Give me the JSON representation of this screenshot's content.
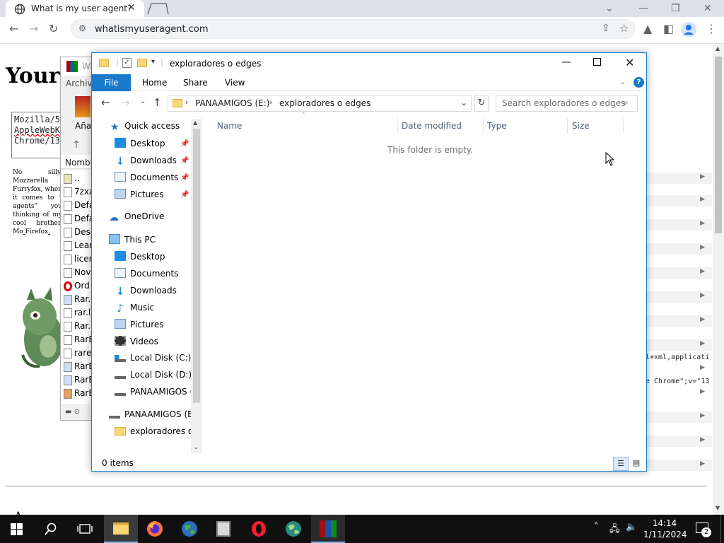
{
  "browser": {
    "tab_title": "What is my user agent?",
    "url": "whatismyuseragent.com",
    "colors": {
      "accent": "#1a73e8",
      "chrome_bg": "#dee1e6"
    }
  },
  "page": {
    "heading": "Your",
    "ua_lines": [
      "Mozilla/5",
      "AppleWebK",
      "Chrome/13"
    ],
    "paragraph_parts": [
      "No silly, Mozzarella Furryfox, when it comes to “",
      " agents” you thinking of my cool brother, ",
      "Mo",
      " ",
      "Firefox",
      "."
    ],
    "snippets": [
      "l+xml,applicati",
      "e Chrome\";v=\"13"
    ],
    "bottom_text": "A"
  },
  "winrar": {
    "title": "Wi",
    "menu": "Archivo",
    "add_label": "Aña",
    "col_name": "Nombr",
    "rows": [
      "..",
      "7zxa",
      "Defa",
      "Defa",
      "Desc",
      "Lear",
      "licer",
      "Nov",
      "Ord",
      "Rar.",
      "rar.l",
      "Rar.:",
      "RarE",
      "rare",
      "RarE",
      "RarE",
      "RarE"
    ]
  },
  "explorer": {
    "title": "exploradores o edges",
    "ribbon": {
      "file": "File",
      "home": "Home",
      "share": "Share",
      "view": "View"
    },
    "breadcrumb": [
      "PANAAMIGOS (E:)",
      "exploradores o edges"
    ],
    "search_placeholder": "Search exploradores o edges",
    "columns": {
      "name": "Name",
      "date": "Date modified",
      "type": "Type",
      "size": "Size"
    },
    "empty_message": "This folder is empty.",
    "status": "0 items",
    "nav": {
      "quick_access": "Quick access",
      "qa_items": [
        "Desktop",
        "Downloads",
        "Documents",
        "Pictures"
      ],
      "onedrive": "OneDrive",
      "this_pc": "This PC",
      "pc_items": [
        "Desktop",
        "Documents",
        "Downloads",
        "Music",
        "Pictures",
        "Videos",
        "Local Disk (C:)",
        "Local Disk (D:)",
        "PANAAMIGOS (E"
      ],
      "drive": "PANAAMIGOS (E:)",
      "folder": "exploradores o e"
    }
  },
  "taskbar": {
    "time": "14:14",
    "date": "1/11/2024",
    "notifications": "2"
  }
}
